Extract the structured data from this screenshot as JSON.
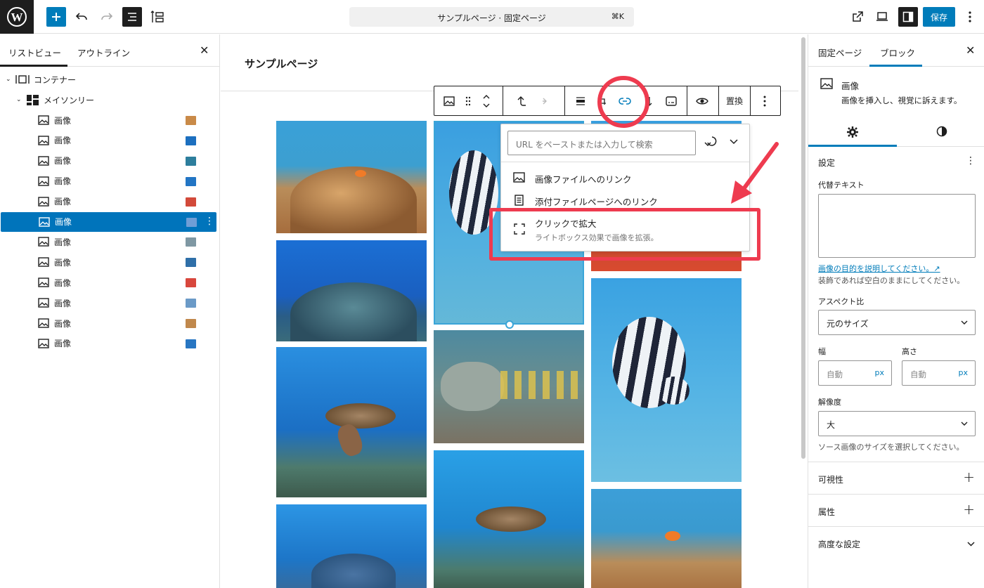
{
  "app": {
    "save_label": "保存"
  },
  "command": {
    "title": "サンプルページ · 固定ページ",
    "shortcut": "⌘K"
  },
  "list_view": {
    "tabs": [
      "リストビュー",
      "アウトライン"
    ],
    "tree": [
      {
        "label": "コンテナー"
      },
      {
        "label": "メイソンリー"
      }
    ],
    "items": [
      {
        "label": "画像",
        "thumb": "#c98a48"
      },
      {
        "label": "画像",
        "thumb": "#1c6fbf"
      },
      {
        "label": "画像",
        "thumb": "#2d7e9d"
      },
      {
        "label": "画像",
        "thumb": "#2275c4"
      },
      {
        "label": "画像",
        "thumb": "#d24a3a"
      },
      {
        "label": "画像",
        "thumb": "#6f9ed6"
      },
      {
        "label": "画像",
        "thumb": "#7f98a3"
      },
      {
        "label": "画像",
        "thumb": "#2f6fa8"
      },
      {
        "label": "画像",
        "thumb": "#d8473d"
      },
      {
        "label": "画像",
        "thumb": "#6b9ac7"
      },
      {
        "label": "画像",
        "thumb": "#c0884c"
      },
      {
        "label": "画像",
        "thumb": "#2876c2"
      }
    ]
  },
  "editor": {
    "page_title": "サンプルページ",
    "toolbar": {
      "replace": "置換"
    }
  },
  "link_popover": {
    "url_placeholder": "URL をペーストまたは入力して検索",
    "options": [
      {
        "title": "画像ファイルへのリンク"
      },
      {
        "title": "添付ファイルページへのリンク"
      },
      {
        "title": "クリックで拡大",
        "desc": "ライトボックス効果で画像を拡張。"
      }
    ]
  },
  "sidebar": {
    "tabs": [
      "固定ページ",
      "ブロック"
    ],
    "block_name": "画像",
    "block_desc": "画像を挿入し、視覚に訴えます。",
    "settings_title": "設定",
    "alt_label": "代替テキスト",
    "alt_value": "",
    "alt_help_link": "画像の目的を説明してください。↗",
    "alt_help": "装飾であれば空白のままにしてください。",
    "aspect_label": "アスペクト比",
    "aspect_value": "元のサイズ",
    "width_label": "幅",
    "height_label": "高さ",
    "width_placeholder": "自動",
    "height_placeholder": "自動",
    "unit": "px",
    "resolution_label": "解像度",
    "resolution_value": "大",
    "resolution_help": "ソース画像のサイズを選択してください。",
    "sections": [
      "可視性",
      "属性",
      "高度な設定"
    ]
  },
  "colors": {
    "accent": "#007cba",
    "highlight": "#ee3b4f"
  }
}
